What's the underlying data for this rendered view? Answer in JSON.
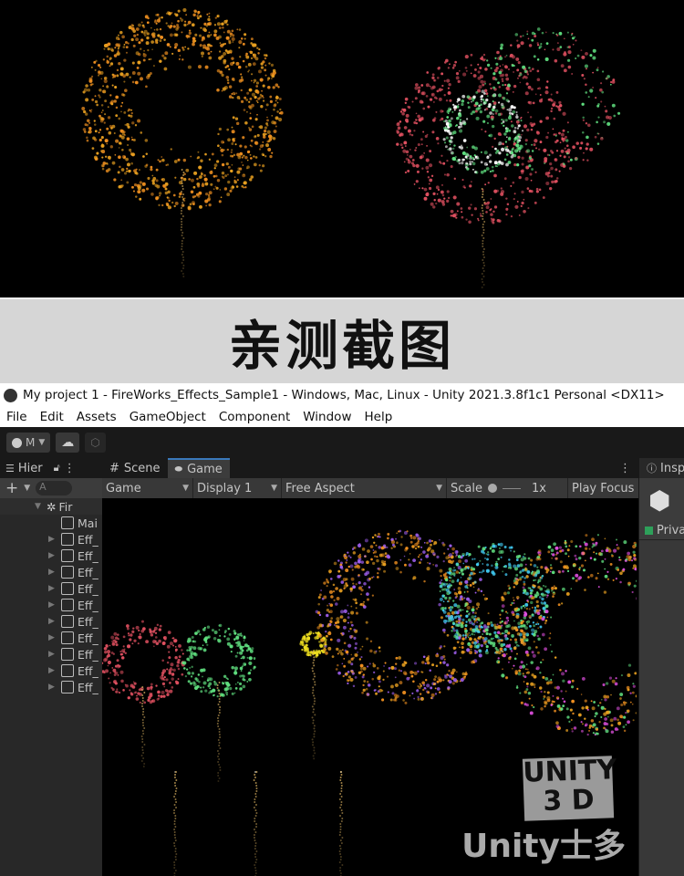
{
  "banner": {
    "text": "亲测截图"
  },
  "window": {
    "title": "My project 1 - FireWorks_Effects_Sample1 - Windows, Mac, Linux - Unity 2021.3.8f1c1 Personal <DX11>"
  },
  "menu": [
    "File",
    "Edit",
    "Assets",
    "GameObject",
    "Component",
    "Window",
    "Help"
  ],
  "toolbar": {
    "account_label": "M"
  },
  "hierarchy": {
    "tab": "Hier",
    "scene": "Fir",
    "items": [
      {
        "label": "Mai",
        "expandable": false
      },
      {
        "label": "Eff_",
        "expandable": true
      },
      {
        "label": "Eff_",
        "expandable": true
      },
      {
        "label": "Eff_",
        "expandable": true
      },
      {
        "label": "Eff_",
        "expandable": true
      },
      {
        "label": "Eff_",
        "expandable": true
      },
      {
        "label": "Eff_",
        "expandable": true
      },
      {
        "label": "Eff_",
        "expandable": true
      },
      {
        "label": "Eff_",
        "expandable": true
      },
      {
        "label": "Eff_",
        "expandable": true
      },
      {
        "label": "Eff_",
        "expandable": true
      }
    ],
    "search_placeholder": "A"
  },
  "center": {
    "tabs": [
      "Scene",
      "Game"
    ],
    "active_tab": "Game",
    "game_select": "Game",
    "display": "Display 1",
    "aspect": "Free Aspect",
    "scale_label": "Scale",
    "scale_value": "1x",
    "play_focus": "Play Focus"
  },
  "inspector": {
    "tab": "Insp",
    "private_label": "Priva"
  },
  "watermark": {
    "line1": "UNITY",
    "line2": "3 D",
    "line3": "Unity士多"
  },
  "fireworks_colors": {
    "gold": "#e8a020",
    "red": "#e05060",
    "green": "#60e080",
    "yellow": "#f0e020",
    "cyan": "#40c8f0",
    "purple": "#a060f0",
    "magenta": "#e050e0",
    "orange": "#f09020"
  }
}
